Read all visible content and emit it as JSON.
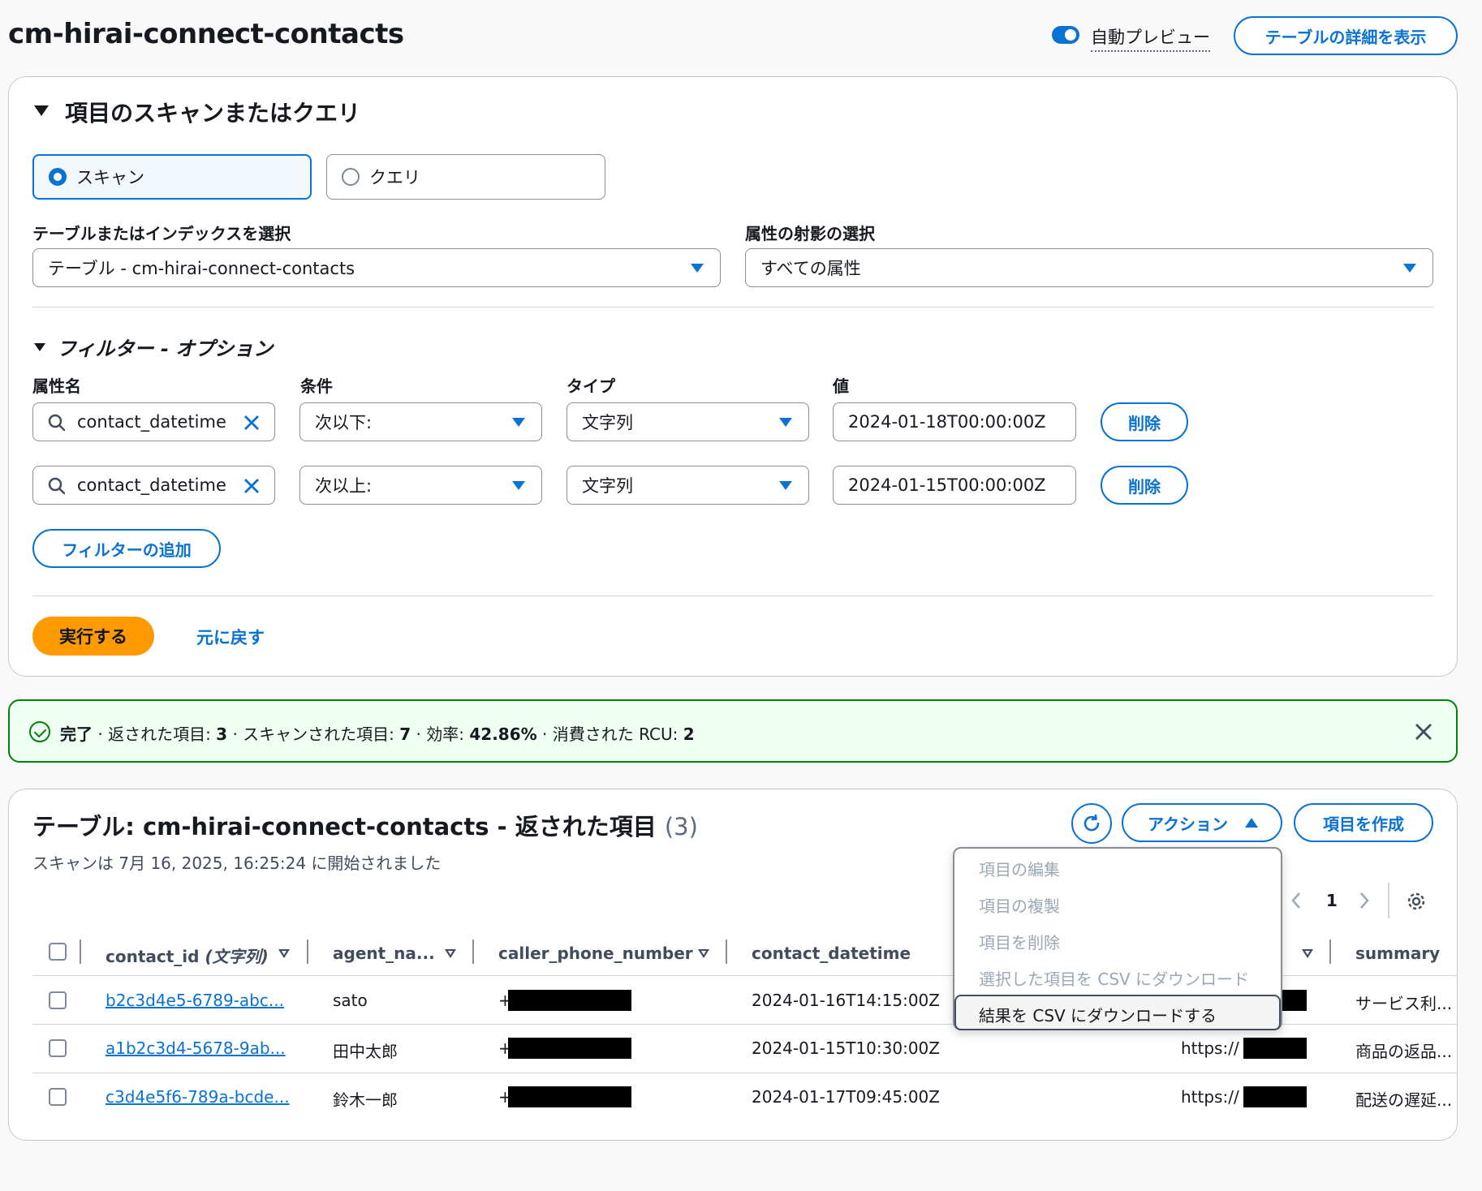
{
  "header": {
    "title": "cm-hirai-connect-contacts",
    "auto_preview_label": "自動プレビュー",
    "auto_preview_on": true,
    "details_button": "テーブルの詳細を表示"
  },
  "scan_panel": {
    "title": "項目のスキャンまたはクエリ",
    "mode_scan": "スキャン",
    "mode_query": "クエリ",
    "selected_mode": "scan",
    "table_label": "テーブルまたはインデックスを選択",
    "table_value": "テーブル - cm-hirai-connect-contacts",
    "projection_label": "属性の射影の選択",
    "projection_value": "すべての属性",
    "filter_title": "フィルター - オプション",
    "col_attr": "属性名",
    "col_cond": "条件",
    "col_type": "タイプ",
    "col_value": "値",
    "filters": [
      {
        "attr": "contact_datetime",
        "cond": "次以下:",
        "type": "文字列",
        "value": "2024-01-18T00:00:00Z",
        "remove": "削除"
      },
      {
        "attr": "contact_datetime",
        "cond": "次以上:",
        "type": "文字列",
        "value": "2024-01-15T00:00:00Z",
        "remove": "削除"
      }
    ],
    "add_filter": "フィルターの追加",
    "run": "実行する",
    "reset": "元に戻す"
  },
  "banner": {
    "status": "完了",
    "returned_label": "· 返された項目:",
    "returned": "3",
    "scanned_label": "· スキャンされた項目:",
    "scanned": "7",
    "eff_label": "· 効率:",
    "efficiency": "42.86%",
    "rcu_label": "· 消費された RCU:",
    "rcu": "2"
  },
  "results": {
    "title": "テーブル: cm-hirai-connect-contacts - 返された項目",
    "count": "(3)",
    "subtitle": "スキャンは 7月 16, 2025, 16:25:24 に開始されました",
    "actions": "アクション",
    "create": "項目を作成",
    "page": "1",
    "columns": [
      "contact_id",
      "(文字列)",
      "agent_na...",
      "caller_phone_number",
      "contact_datetime",
      "summary"
    ],
    "rows": [
      {
        "id": "b2c3d4e5-6789-abc...",
        "agent": "sato",
        "phone": "+",
        "datetime": "2024-01-16T14:15:00Z",
        "url": "",
        "summary": "サービス利..."
      },
      {
        "id": "a1b2c3d4-5678-9ab...",
        "agent": "田中太郎",
        "phone": "+",
        "datetime": "2024-01-15T10:30:00Z",
        "url": "https://",
        "summary": "商品の返品..."
      },
      {
        "id": "c3d4e5f6-789a-bcde...",
        "agent": "鈴木一郎",
        "phone": "+",
        "datetime": "2024-01-17T09:45:00Z",
        "url": "https://",
        "summary": "配送の遅延..."
      }
    ],
    "menu": [
      "項目の編集",
      "項目の複製",
      "項目を削除",
      "選択した項目を CSV にダウンロード",
      "結果を CSV にダウンロードする"
    ]
  },
  "colors": {
    "accent": "#0972d3",
    "primary_button": "#ff9900",
    "success": "#037f0c"
  }
}
